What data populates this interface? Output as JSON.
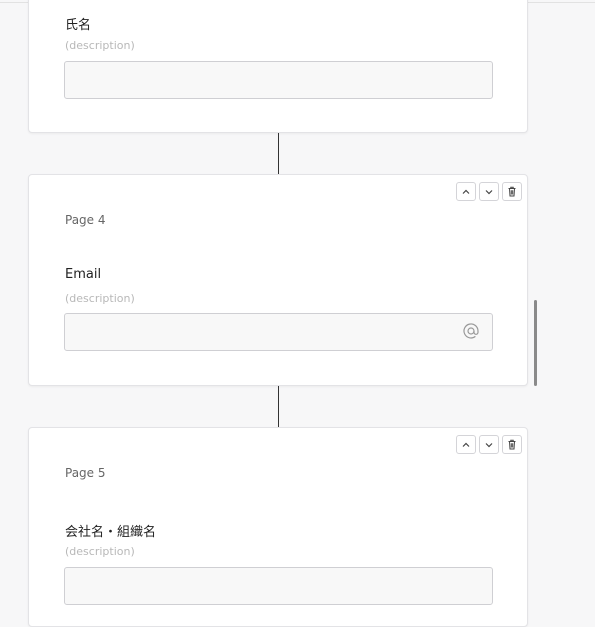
{
  "cards": [
    {
      "field_label": "氏名",
      "description": "(description)"
    },
    {
      "page_label": "Page 4",
      "field_label": "Email",
      "description": "(description)",
      "input_icon": "at-icon",
      "controls": [
        "chevron-up-icon",
        "chevron-down-icon",
        "trash-icon"
      ]
    },
    {
      "page_label": "Page 5",
      "field_label": "会社名・組織名",
      "description": "(description)",
      "controls": [
        "chevron-up-icon",
        "chevron-down-icon",
        "trash-icon"
      ]
    }
  ]
}
